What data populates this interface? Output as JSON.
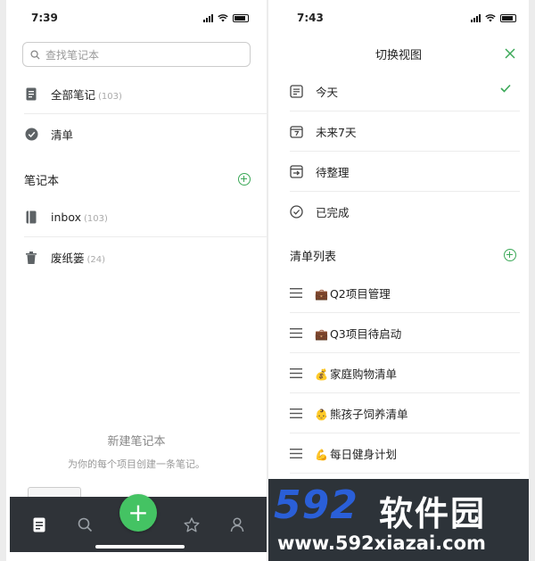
{
  "left": {
    "status_time": "7:39",
    "search_placeholder": "查找笔记本",
    "top_items": [
      {
        "label": "全部笔记",
        "count": "(103)"
      },
      {
        "label": "清单",
        "count": ""
      }
    ],
    "notebooks_title": "笔记本",
    "notebooks": [
      {
        "label": "inbox",
        "count": "(103)"
      },
      {
        "label": "废纸篓",
        "count": "(24)"
      }
    ],
    "empty_title": "新建笔记本",
    "empty_sub": "为你的每个项目创建一条笔记。",
    "fab_label": "+"
  },
  "right": {
    "status_time": "7:43",
    "title": "切换视图",
    "views": [
      {
        "label": "今天",
        "selected": true
      },
      {
        "label": "未来7天",
        "selected": false
      },
      {
        "label": "待整理",
        "selected": false
      },
      {
        "label": "已完成",
        "selected": false
      }
    ],
    "lists_title": "清单列表",
    "lists": [
      {
        "emoji": "💼",
        "label": "Q2项目管理"
      },
      {
        "emoji": "💼",
        "label": "Q3项目待启动"
      },
      {
        "emoji": "💰",
        "label": "家庭购物清单"
      },
      {
        "emoji": "👶",
        "label": "熊孩子饲养清单"
      },
      {
        "emoji": "💪",
        "label": "每日健身计划"
      }
    ]
  },
  "watermark": {
    "logo": "592",
    "name": "软件园",
    "url": "www.592xiazai.com"
  },
  "colors": {
    "accent": "#44c363",
    "tabbar": "#2f3338"
  }
}
